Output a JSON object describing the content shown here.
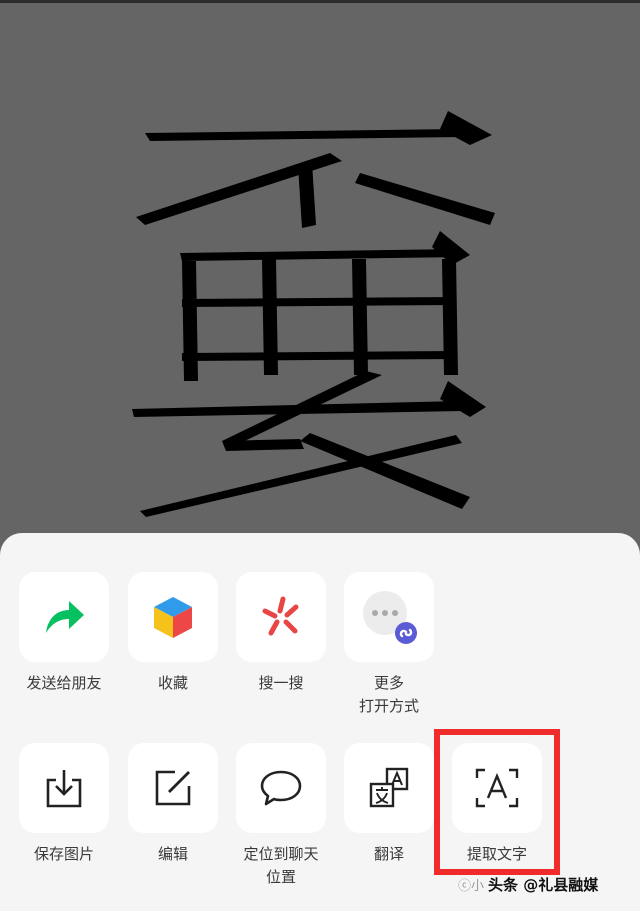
{
  "preview": {
    "glyph_name": "stylized-character-image"
  },
  "actions_row1": [
    {
      "label": "发送给朋友",
      "icon": "share-arrow-icon"
    },
    {
      "label": "收藏",
      "icon": "favorite-cube-icon"
    },
    {
      "label": "搜一搜",
      "icon": "search-star-icon"
    },
    {
      "label_line1": "更多",
      "label_line2": "打开方式",
      "icon": "more-open-with-icon"
    }
  ],
  "actions_row2": [
    {
      "label": "保存图片",
      "icon": "save-download-icon"
    },
    {
      "label": "编辑",
      "icon": "edit-pen-icon"
    },
    {
      "label_line1": "定位到聊天",
      "label_line2": "位置",
      "icon": "chat-bubble-icon"
    },
    {
      "label": "翻译",
      "icon": "translate-icon"
    },
    {
      "label": "提取文字",
      "icon": "extract-text-icon"
    }
  ],
  "watermark": {
    "faint": "ⓒ小",
    "text": "头条 @礼县融媒"
  },
  "colors": {
    "highlight": "#ef2b2b",
    "share_green": "#07c160",
    "search_red": "#e84545"
  }
}
